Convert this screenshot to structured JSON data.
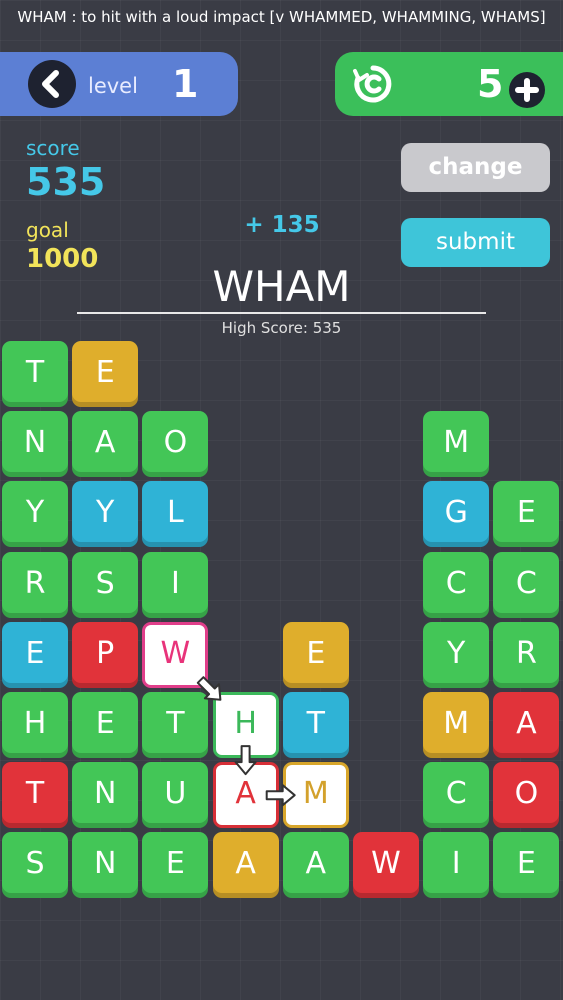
{
  "definition": "WHAM : to hit with a loud impact [v WHAMMED, WHAMMING, WHAMS]",
  "level": {
    "label": "level",
    "value": "1",
    "back_icon": "chevron-left-icon"
  },
  "shuffle": {
    "icon": "shuffle-icon",
    "count": "5",
    "add_icon": "plus-icon"
  },
  "score": {
    "label": "score",
    "value": "535"
  },
  "goal": {
    "label": "goal",
    "value": "1000"
  },
  "buttons": {
    "change": "change",
    "submit": "submit"
  },
  "points_gain": "+ 135",
  "current_word": "WHAM",
  "high_score": "High Score: 535",
  "colors": {
    "green": "#43c657",
    "blue": "#2fb3d6",
    "gold": "#dfae2c",
    "red": "#e1333a",
    "level_bar": "#5c7fd4",
    "shuffle_bar": "#3bbf5a",
    "score": "#45c8e8",
    "goal": "#f2e45a"
  },
  "board": {
    "columns": 8,
    "rows": 8,
    "tiles": [
      {
        "letter": "T",
        "color": "green",
        "col": 0,
        "row": 0
      },
      {
        "letter": "E",
        "color": "gold",
        "col": 1,
        "row": 0
      },
      {
        "letter": "N",
        "color": "green",
        "col": 0,
        "row": 1
      },
      {
        "letter": "A",
        "color": "green",
        "col": 1,
        "row": 1
      },
      {
        "letter": "O",
        "color": "green",
        "col": 2,
        "row": 1
      },
      {
        "letter": "M",
        "color": "green",
        "col": 6,
        "row": 1
      },
      {
        "letter": "Y",
        "color": "green",
        "col": 0,
        "row": 2
      },
      {
        "letter": "Y",
        "color": "blue",
        "col": 1,
        "row": 2
      },
      {
        "letter": "L",
        "color": "blue",
        "col": 2,
        "row": 2
      },
      {
        "letter": "G",
        "color": "blue",
        "col": 6,
        "row": 2
      },
      {
        "letter": "E",
        "color": "green",
        "col": 7,
        "row": 2
      },
      {
        "letter": "R",
        "color": "green",
        "col": 0,
        "row": 3
      },
      {
        "letter": "S",
        "color": "green",
        "col": 1,
        "row": 3
      },
      {
        "letter": "I",
        "color": "green",
        "col": 2,
        "row": 3
      },
      {
        "letter": "C",
        "color": "green",
        "col": 6,
        "row": 3
      },
      {
        "letter": "C",
        "color": "green",
        "col": 7,
        "row": 3
      },
      {
        "letter": "E",
        "color": "blue",
        "col": 0,
        "row": 4
      },
      {
        "letter": "P",
        "color": "red",
        "col": 1,
        "row": 4
      },
      {
        "letter": "W",
        "color": "sel-pink",
        "col": 2,
        "row": 4
      },
      {
        "letter": "E",
        "color": "gold",
        "col": 4,
        "row": 4
      },
      {
        "letter": "Y",
        "color": "green",
        "col": 6,
        "row": 4
      },
      {
        "letter": "R",
        "color": "green",
        "col": 7,
        "row": 4
      },
      {
        "letter": "H",
        "color": "green",
        "col": 0,
        "row": 5
      },
      {
        "letter": "E",
        "color": "green",
        "col": 1,
        "row": 5
      },
      {
        "letter": "T",
        "color": "green",
        "col": 2,
        "row": 5
      },
      {
        "letter": "H",
        "color": "sel-green",
        "col": 3,
        "row": 5
      },
      {
        "letter": "T",
        "color": "blue",
        "col": 4,
        "row": 5
      },
      {
        "letter": "M",
        "color": "gold",
        "col": 6,
        "row": 5
      },
      {
        "letter": "A",
        "color": "red",
        "col": 7,
        "row": 5
      },
      {
        "letter": "T",
        "color": "red",
        "col": 0,
        "row": 6
      },
      {
        "letter": "N",
        "color": "green",
        "col": 1,
        "row": 6
      },
      {
        "letter": "U",
        "color": "green",
        "col": 2,
        "row": 6
      },
      {
        "letter": "A",
        "color": "sel-red",
        "col": 3,
        "row": 6
      },
      {
        "letter": "M",
        "color": "sel-gold",
        "col": 4,
        "row": 6
      },
      {
        "letter": "C",
        "color": "green",
        "col": 6,
        "row": 6
      },
      {
        "letter": "O",
        "color": "red",
        "col": 7,
        "row": 6
      },
      {
        "letter": "S",
        "color": "green",
        "col": 0,
        "row": 7
      },
      {
        "letter": "N",
        "color": "green",
        "col": 1,
        "row": 7
      },
      {
        "letter": "E",
        "color": "green",
        "col": 2,
        "row": 7
      },
      {
        "letter": "A",
        "color": "gold",
        "col": 3,
        "row": 7
      },
      {
        "letter": "A",
        "color": "green",
        "col": 4,
        "row": 7
      },
      {
        "letter": "W",
        "color": "red",
        "col": 5,
        "row": 7
      },
      {
        "letter": "I",
        "color": "green",
        "col": 6,
        "row": 7
      },
      {
        "letter": "E",
        "color": "green",
        "col": 7,
        "row": 7
      }
    ]
  },
  "path_arrows": [
    {
      "from": [
        2,
        4
      ],
      "to": [
        3,
        5
      ]
    },
    {
      "from": [
        3,
        5
      ],
      "to": [
        3,
        6
      ]
    },
    {
      "from": [
        3,
        6
      ],
      "to": [
        4,
        6
      ]
    }
  ]
}
